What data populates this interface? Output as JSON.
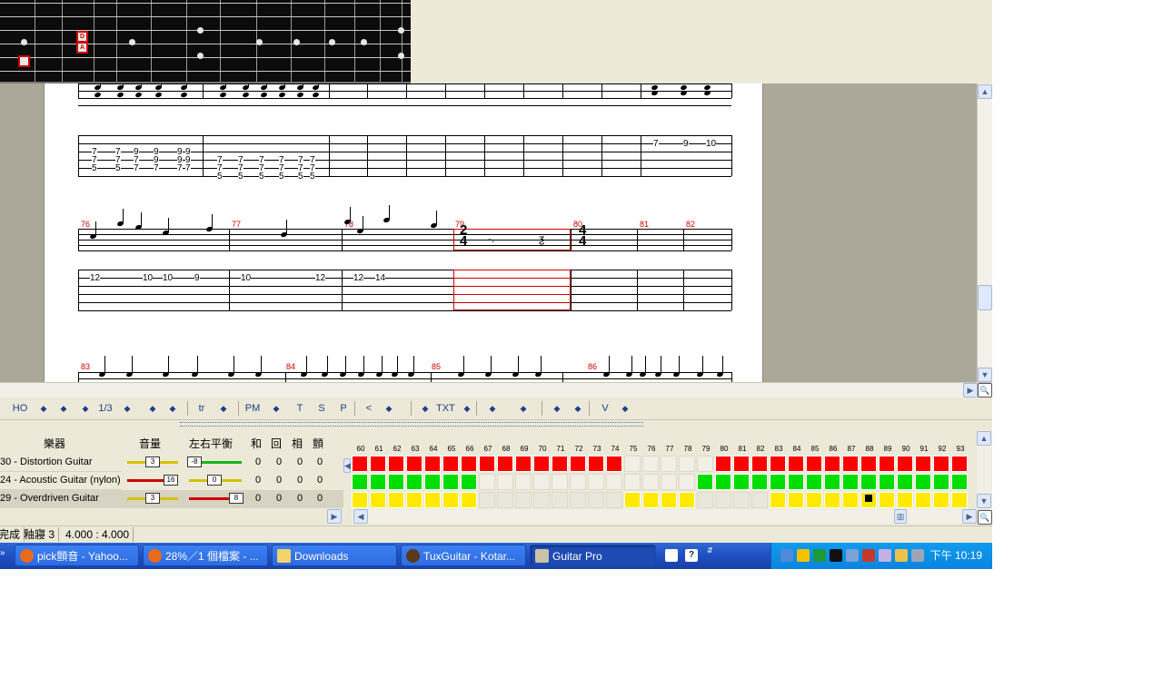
{
  "score": {
    "system1": {
      "tab_rows": [
        [
          "7",
          "7",
          "9",
          "9",
          "9",
          "9"
        ],
        [
          "7",
          "7",
          "7",
          "9",
          "9",
          "9"
        ],
        [
          "5",
          "5",
          "7",
          "7",
          "7",
          "7"
        ]
      ],
      "tab_rows_b": [
        [
          "7",
          "7",
          "7",
          "7",
          "7",
          "7"
        ],
        [
          "7",
          "7",
          "7",
          "7",
          "7",
          "7"
        ],
        [
          "5",
          "5",
          "5",
          "5",
          "5",
          "5"
        ]
      ],
      "end_tabs": [
        "7",
        "9",
        "10"
      ]
    },
    "system2": {
      "measures": [
        "76",
        "77",
        "78",
        "79",
        "80",
        "81",
        "82"
      ],
      "tab_numbers": [
        "12",
        "10",
        "10",
        "9",
        "10",
        "12",
        "12",
        "14"
      ],
      "time_sig_79": [
        "2",
        "4"
      ],
      "time_sig_80": [
        "4",
        "4"
      ]
    },
    "system3": {
      "measures": [
        "83",
        "84",
        "85",
        "86"
      ]
    }
  },
  "toolbar": {
    "items": [
      "HO",
      "1/3",
      "tr",
      "PM",
      "T",
      "S",
      "P",
      "<",
      "TXT",
      "V"
    ]
  },
  "tracks": {
    "headers": {
      "instrument": "樂器",
      "volume": "音量",
      "pan": "左右平衡",
      "chorus": "和",
      "reverb": "回",
      "phaser": "相",
      "tremolo": "顫"
    },
    "rows": [
      {
        "name": "30 - Distortion Guitar",
        "volume": "3",
        "pan": "-8",
        "chorus": "0",
        "reverb": "0",
        "phaser": "0",
        "tremolo": "0",
        "vol_color": "#d4c200",
        "pan_color": "#1bb51b"
      },
      {
        "name": "24 - Acoustic Guitar (nylon)",
        "volume": "16",
        "pan": "0",
        "chorus": "0",
        "reverb": "0",
        "phaser": "0",
        "tremolo": "0",
        "vol_color": "#d10000",
        "pan_color": "#d4c200"
      },
      {
        "name": "29 - Overdriven Guitar",
        "volume": "3",
        "pan": "8",
        "chorus": "0",
        "reverb": "0",
        "phaser": "0",
        "tremolo": "0",
        "vol_color": "#d4c200",
        "pan_color": "#d10000"
      }
    ],
    "measure_numbers": [
      "60",
      "61",
      "62",
      "63",
      "64",
      "65",
      "66",
      "67",
      "68",
      "69",
      "70",
      "71",
      "72",
      "73",
      "74",
      "75",
      "76",
      "77",
      "78",
      "79",
      "80",
      "81",
      "82",
      "83",
      "84",
      "85",
      "86",
      "87",
      "88",
      "89",
      "90",
      "91",
      "92",
      "93"
    ],
    "track_colors": [
      "#ff0000",
      "#00dd00",
      "#ffea00"
    ]
  },
  "status": {
    "left": "完成",
    "middle": "釉寢 3",
    "position": "4.000 : 4.000"
  },
  "taskbar": {
    "tasks": [
      {
        "label": "pick顫音 - Yahoo..."
      },
      {
        "label": "28%／1 個檔案 - ..."
      },
      {
        "label": "Downloads"
      },
      {
        "label": "TuxGuitar - Kotar..."
      },
      {
        "label": "Guitar Pro"
      }
    ],
    "clock": "下午 10:19"
  }
}
